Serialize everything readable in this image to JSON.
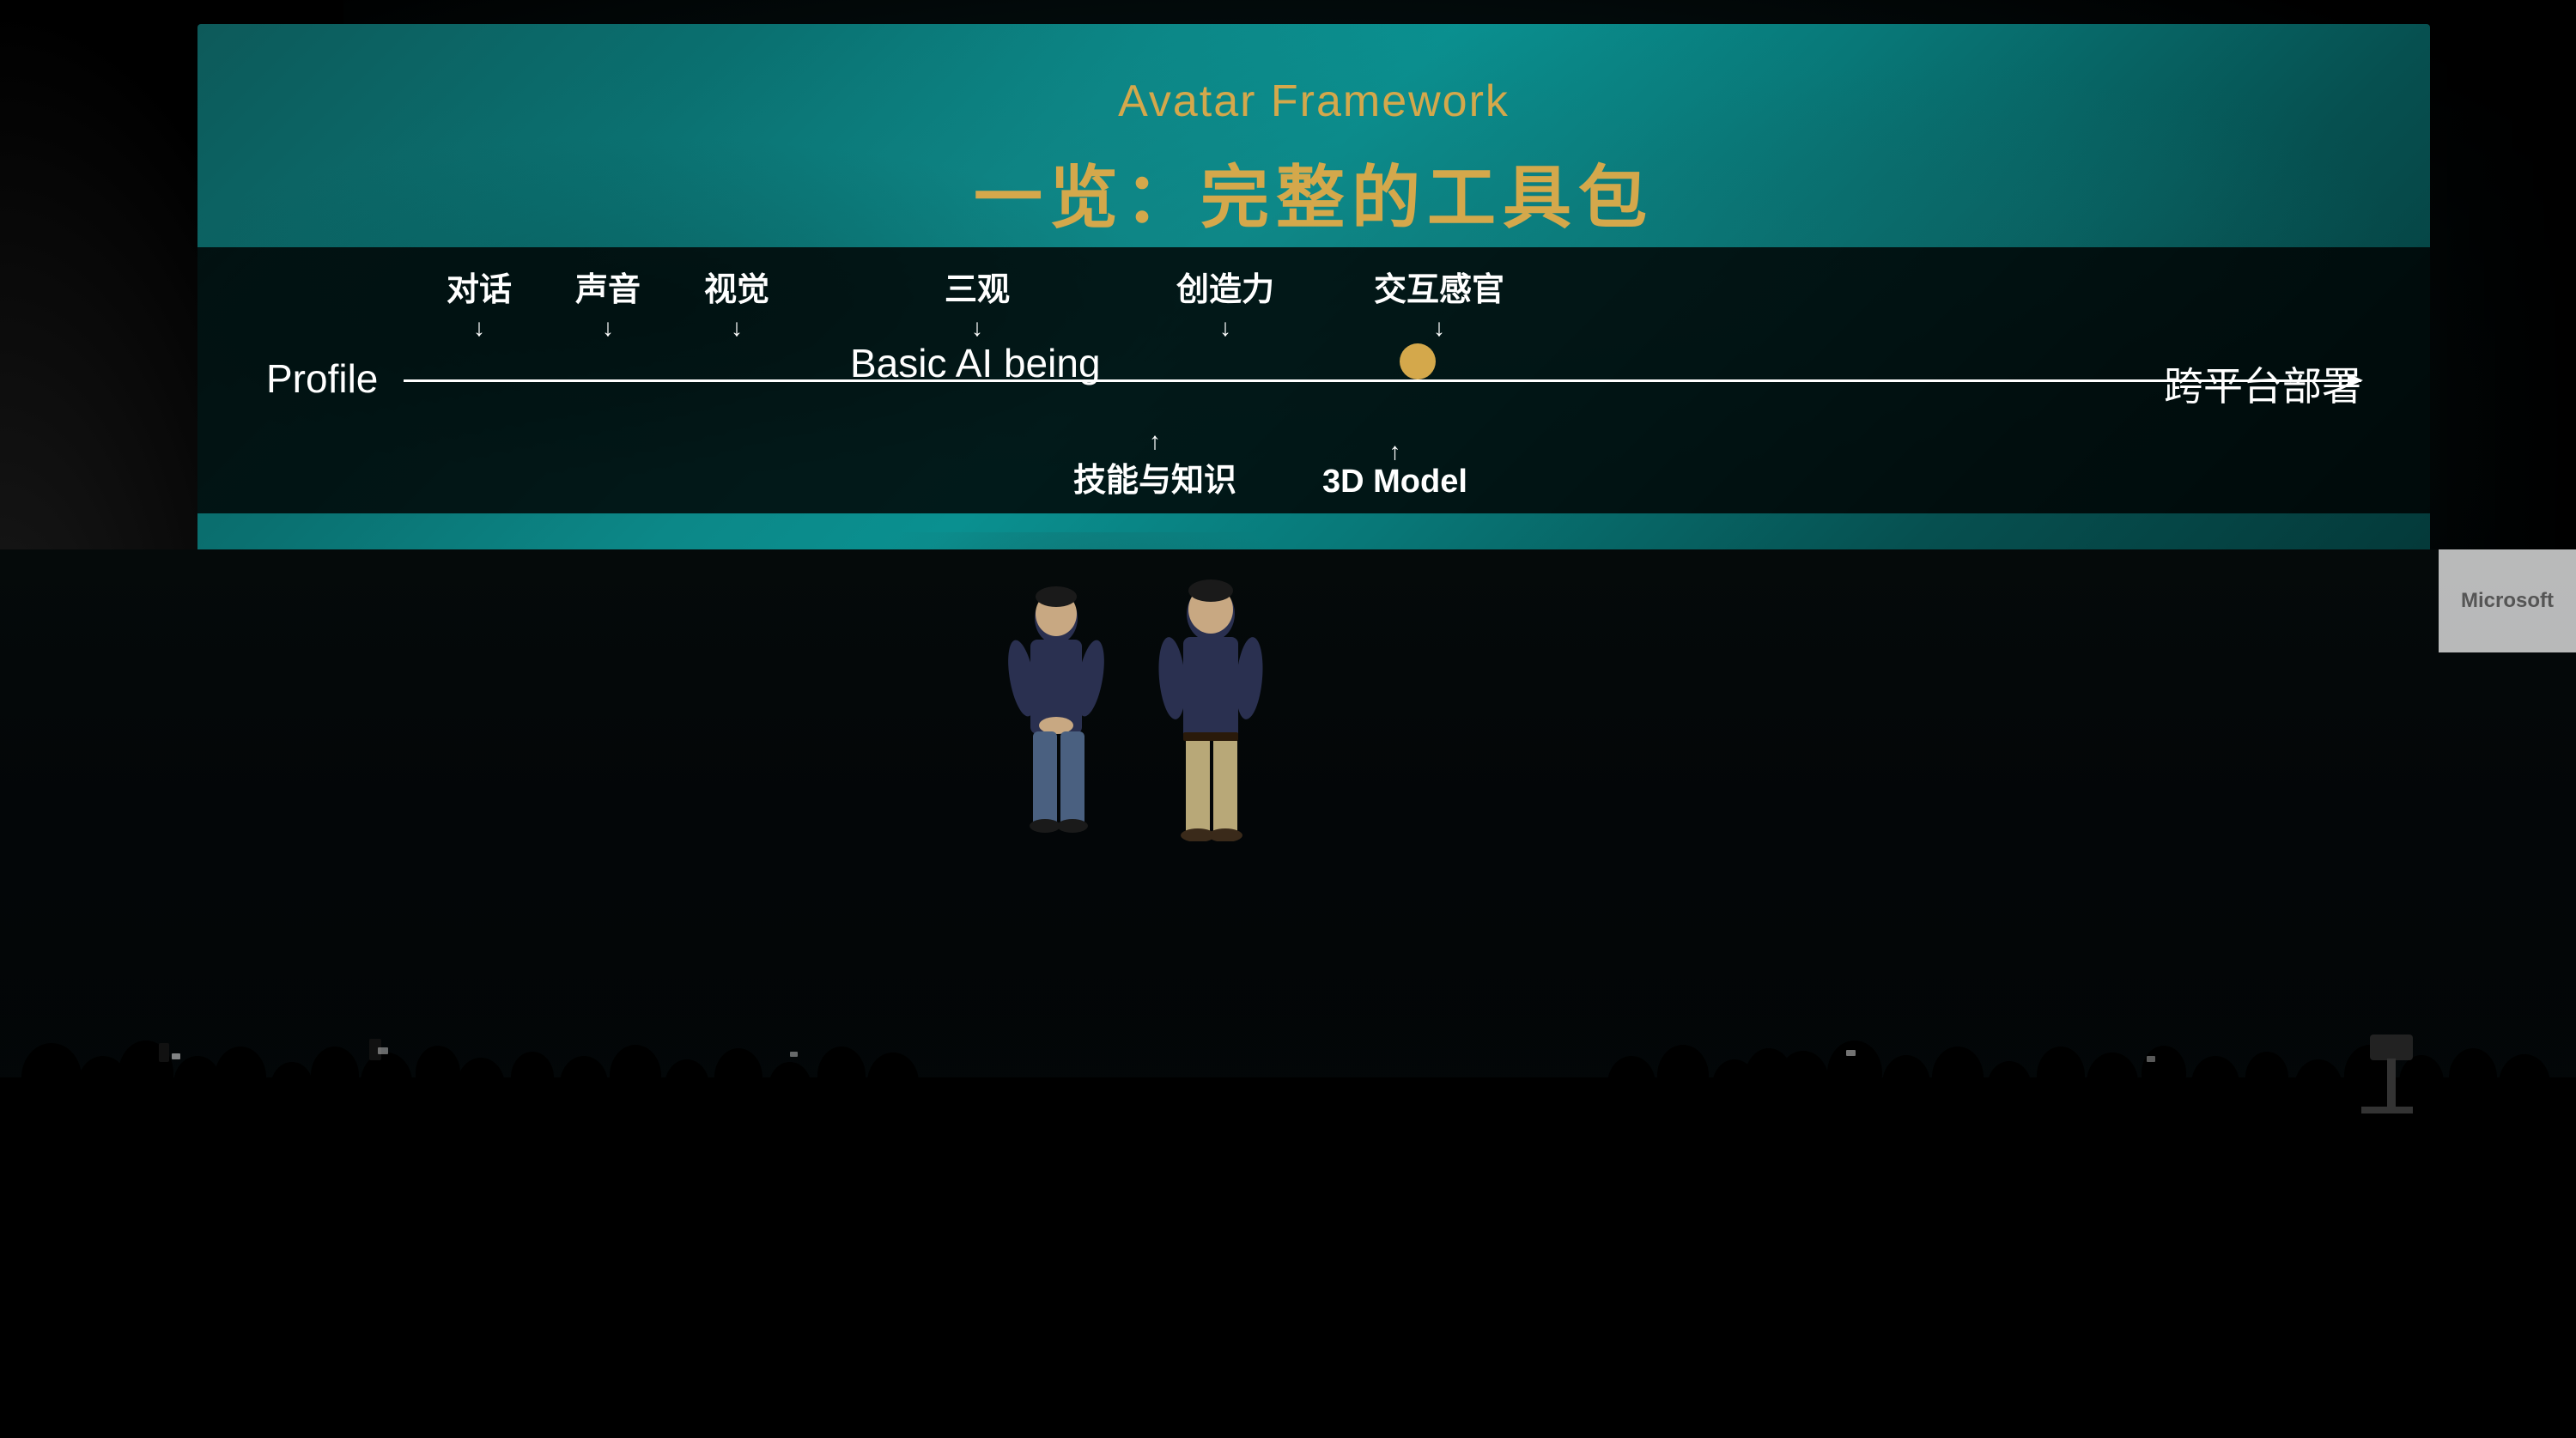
{
  "scene": {
    "background_color": "#000000"
  },
  "screen": {
    "title_en": "Avatar Framework",
    "title_zh": "一览：完整的工具包",
    "title_color": "#d4a84b"
  },
  "diagram": {
    "left_label": "Profile",
    "middle_label": "Basic AI being",
    "right_label": "跨平台部署",
    "labels_above": [
      {
        "text": "对话",
        "arrow": "↓"
      },
      {
        "text": "声音",
        "arrow": "↓"
      },
      {
        "text": "视觉",
        "arrow": "↓"
      },
      {
        "text": "三观",
        "arrow": "↓"
      },
      {
        "text": "创造力",
        "arrow": "↓"
      },
      {
        "text": "交互感官",
        "arrow": "↓"
      }
    ],
    "labels_below": [
      {
        "text": "技能与知识",
        "arrow": "↑"
      },
      {
        "text": "3D Model",
        "arrow": "↑"
      }
    ],
    "line_color": "#ffffff",
    "circle_color": "#d4a84b"
  },
  "right_signage": {
    "text": "Microsoft"
  }
}
